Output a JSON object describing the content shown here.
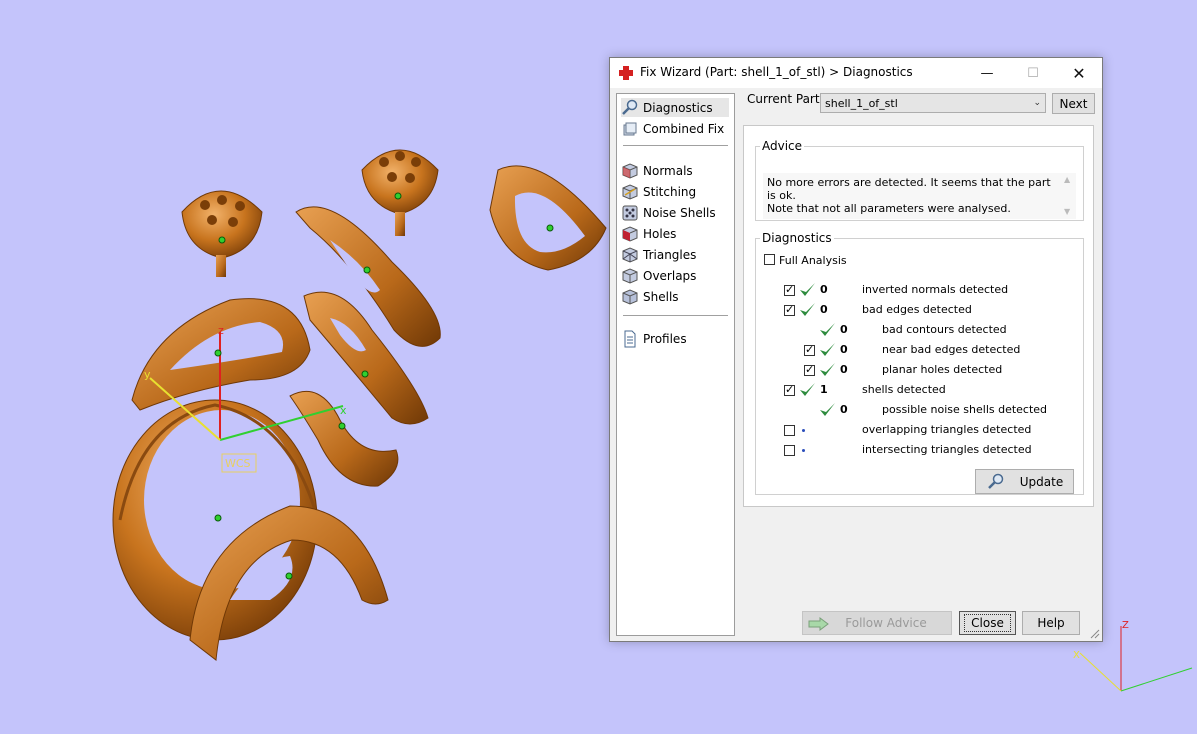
{
  "viewport": {
    "wcs_label": "WCS",
    "axes": {
      "x": "x",
      "y": "y",
      "z": "z"
    },
    "corner_axes": {
      "x": "X",
      "z": "Z"
    }
  },
  "dialog": {
    "title": "Fix Wizard (Part: shell_1_of_stl) > Diagnostics",
    "nav": [
      {
        "label": "Diagnostics",
        "icon": "magnifier-icon",
        "selected": true
      },
      {
        "label": "Combined Fix",
        "icon": "stack-icon"
      },
      {
        "label": "Normals",
        "icon": "cube-normals-icon"
      },
      {
        "label": "Stitching",
        "icon": "cube-stitch-icon"
      },
      {
        "label": "Noise Shells",
        "icon": "dice-icon"
      },
      {
        "label": "Holes",
        "icon": "cube-holes-icon"
      },
      {
        "label": "Triangles",
        "icon": "cube-triangles-icon"
      },
      {
        "label": "Overlaps",
        "icon": "cube-overlaps-icon"
      },
      {
        "label": "Shells",
        "icon": "cube-shells-icon"
      },
      {
        "label": "Profiles",
        "icon": "document-icon"
      }
    ],
    "current_part_label": "Current Part:",
    "current_part_value": "shell_1_of_stl",
    "next_label": "Next",
    "advice": {
      "legend": "Advice",
      "line1": "No more errors are detected. It seems that the part is ok.",
      "line2": "Note that not all parameters were analysed."
    },
    "diagnostics": {
      "legend": "Diagnostics",
      "full_analysis_label": "Full Analysis",
      "full_analysis_checked": false,
      "rows": [
        {
          "label": "inverted normals detected",
          "count": "0",
          "checked": true,
          "status": "ok"
        },
        {
          "label": "bad edges detected",
          "count": "0",
          "checked": true,
          "status": "ok"
        },
        {
          "label": "bad contours detected",
          "count": "0",
          "status": "ok"
        },
        {
          "label": "near bad edges detected",
          "count": "0",
          "checked": true,
          "status": "ok"
        },
        {
          "label": "planar holes detected",
          "count": "0",
          "checked": true,
          "status": "ok"
        },
        {
          "label": "shells detected",
          "count": "1",
          "checked": true,
          "status": "ok"
        },
        {
          "label": "possible noise shells detected",
          "count": "0",
          "status": "ok"
        },
        {
          "label": "overlapping triangles detected",
          "count": "",
          "checked": false,
          "status": "not-run"
        },
        {
          "label": "intersecting triangles detected",
          "count": "",
          "checked": false,
          "status": "not-run"
        }
      ],
      "update_label": "Update"
    },
    "buttons": {
      "follow_advice": "Follow Advice",
      "close": "Close",
      "help": "Help"
    }
  },
  "colors": {
    "background": "#c4c4fb",
    "jewelry": "#c8741e",
    "ok_green": "#2e8b3e"
  }
}
